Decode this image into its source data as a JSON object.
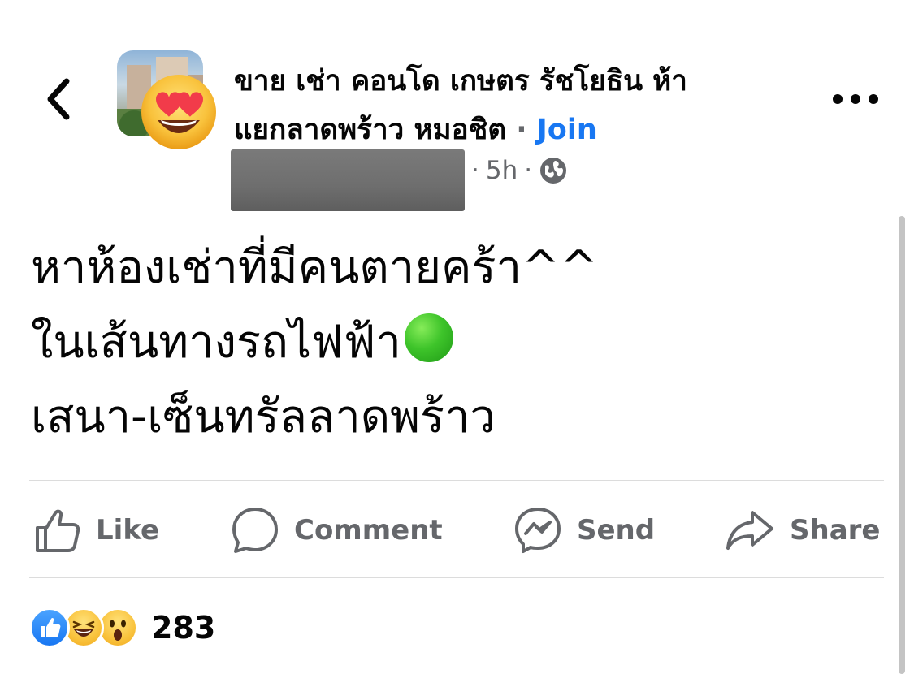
{
  "header": {
    "back_icon": "chevron-left-icon",
    "group_name_line1": "ขาย เช่า คอนโด เกษตร รัชโยธิน ห้า",
    "group_name_line2": "แยกลาดพร้าว หมอชิต",
    "separator": "·",
    "join_label": "Join",
    "more_icon": "more-horizontal-icon",
    "avatar_emoji": "smiling-face-with-heart-eyes-icon"
  },
  "meta": {
    "author_name_redacted": true,
    "dot1": "·",
    "time": "5h",
    "dot2": "·",
    "privacy_icon": "globe-icon"
  },
  "post": {
    "line1": "หาห้องเช่าที่มีคนตายคร้า^^",
    "line2": "ในเส้นทางรถไฟฟ้า",
    "line2_emoji": "green-circle-icon",
    "line3": "เสนา-เซ็นทรัลลาดพร้าว"
  },
  "actions": {
    "like_label": "Like",
    "comment_label": "Comment",
    "send_label": "Send",
    "share_label": "Share"
  },
  "reactions": {
    "icons": [
      "like-reaction-icon",
      "haha-reaction-icon",
      "wow-reaction-icon"
    ],
    "count": "283"
  },
  "colors": {
    "primary_text": "#050505",
    "secondary_text": "#65676b",
    "link_blue": "#1877f2",
    "divider": "#dcdcdc"
  }
}
